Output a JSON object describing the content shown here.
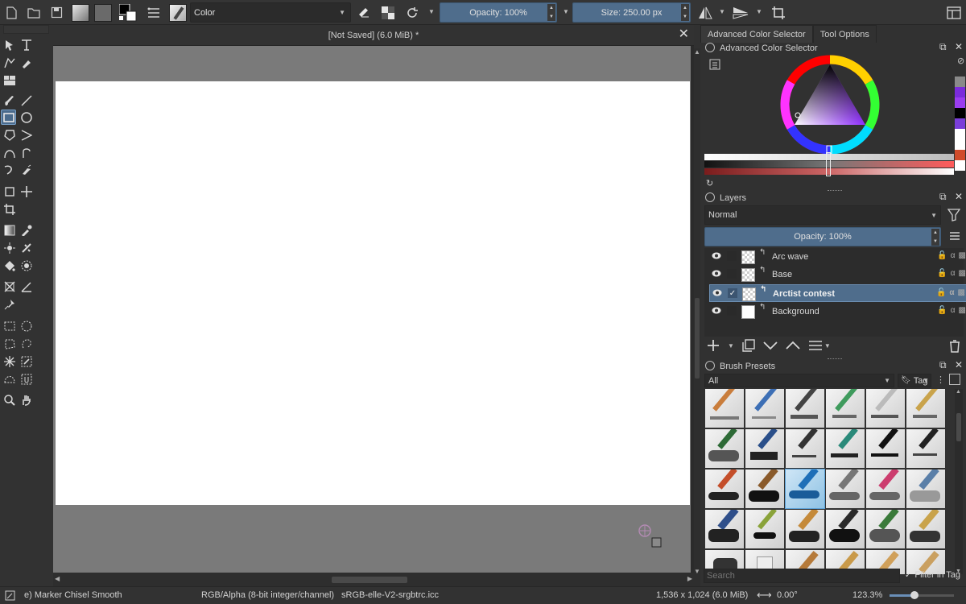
{
  "toolbar": {
    "blend_mode": "Color",
    "opacity": "Opacity: 100%",
    "size": "Size: 250.00 px"
  },
  "document": {
    "title": "[Not Saved]  (6.0 MiB) *"
  },
  "dockers": {
    "tabs": [
      "Advanced Color Selector",
      "Tool Options"
    ],
    "color_selector_title": "Advanced Color Selector",
    "layers_title": "Layers",
    "layer_blend_mode": "Normal",
    "layer_opacity": "Opacity: 100%",
    "layers": [
      {
        "name": "Arc wave",
        "selected": false,
        "thumb": "transparent"
      },
      {
        "name": "Base",
        "selected": false,
        "thumb": "transparent"
      },
      {
        "name": "Arctist contest",
        "selected": true,
        "thumb": "transparent"
      },
      {
        "name": "Background",
        "selected": false,
        "thumb": "white"
      }
    ],
    "brush_presets_title": "Brush Presets",
    "brush_filter": "All",
    "tag_label": "Tag",
    "search_placeholder": "Search",
    "filter_in_tag": "Filter in Tag"
  },
  "statusbar": {
    "brush": "e) Marker Chisel Smooth",
    "color_model": "RGB/Alpha (8-bit integer/channel)",
    "profile": "sRGB-elle-V2-srgbtrc.icc",
    "image_size": "1,536 x 1,024 (6.0 MiB)",
    "rotation": "0.00°",
    "zoom": "123.3%"
  },
  "colors": {
    "accent": "#4f6d8c",
    "panel": "#313131",
    "canvas_bg": "#7a7a7a"
  }
}
